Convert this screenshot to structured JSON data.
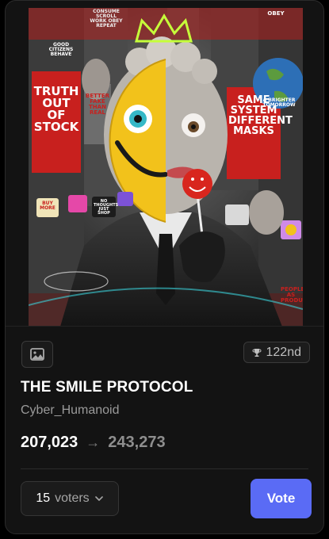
{
  "artwork": {
    "signs": {
      "good_citizens": "GOOD CITIZENS BEHAVE",
      "consume": "CONSUME SCROLL WORK OBEY REPEAT",
      "truth_out_of_stock": "TRUTH OUT OF STOCK",
      "better_fake": "BETTER FAKE THAN REAL",
      "same_system": "SAME SYSTEM DIFFERENT MASKS",
      "brighter_tomorrow": "A BRIGHTER TOMORROW",
      "obey": "OBEY",
      "buy_more": "BUY MORE",
      "no_thoughts": "NO THOUGHTS JUST SHOP",
      "people_products": "PEOPLE AS PRODUCTS"
    }
  },
  "card": {
    "rank": "122nd",
    "title": "THE SMILE PROTOCOL",
    "creator": "Cyber_Humanoid",
    "votes_current": "207,023",
    "votes_arrow": "→",
    "votes_next": "243,273",
    "voters_count": "15",
    "voters_label": "voters",
    "vote_label": "Vote"
  },
  "icons": {
    "media": "image-icon",
    "rank": "trophy-icon",
    "dropdown": "chevron-down-icon"
  },
  "colors": {
    "accent": "#5a6bf5",
    "background": "#131313",
    "smiley_yellow": "#f2c21b",
    "sign_red": "#c8201e"
  }
}
